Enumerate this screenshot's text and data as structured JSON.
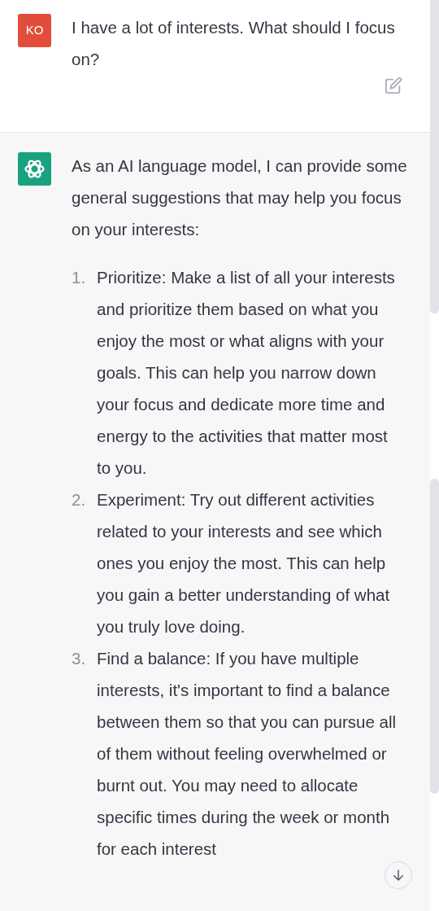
{
  "user_message": {
    "avatar": "KO",
    "text": "I have a lot of interests. What should I focus on?"
  },
  "assistant_message": {
    "intro": "As an AI language model, I can provide some general suggestions that may help you focus on your interests:",
    "items": [
      {
        "number": "1.",
        "text": "Prioritize: Make a list of all your interests and prioritize them based on what you enjoy the most or what aligns with your goals. This can help you narrow down your focus and dedicate more time and energy to the activities that matter most to you."
      },
      {
        "number": "2.",
        "text": "Experiment: Try out different activities related to your interests and see which ones you enjoy the most. This can help you gain a better understanding of what you truly love doing."
      },
      {
        "number": "3.",
        "text": "Find a balance: If you have multiple interests, it's important to find a balance between them so that you can pursue all of them without feeling overwhelmed or burnt out. You may need to allocate specific times during the week or month for each interest"
      }
    ]
  }
}
